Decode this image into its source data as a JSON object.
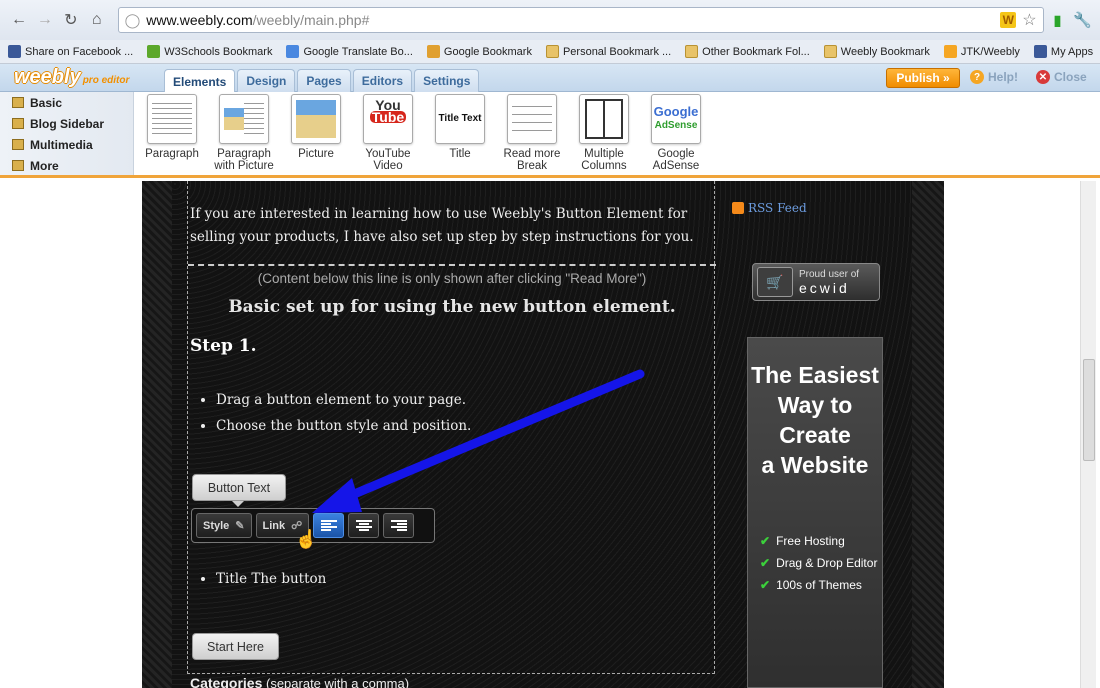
{
  "browser": {
    "url_host": "www.weebly.com",
    "url_path": "/weebly/main.php#",
    "bookmarks": [
      {
        "label": "Share on Facebook ...",
        "icon": "facebook-icon"
      },
      {
        "label": "W3Schools Bookmark",
        "icon": "w3-icon"
      },
      {
        "label": "Google Translate Bo...",
        "icon": "translate-icon"
      },
      {
        "label": "Google Bookmark",
        "icon": "google-icon"
      },
      {
        "label": "Personal Bookmark ...",
        "icon": "folder-icon"
      },
      {
        "label": "Other Bookmark Fol...",
        "icon": "folder-icon"
      },
      {
        "label": "Weebly Bookmark",
        "icon": "folder-icon"
      },
      {
        "label": "JTK/Weebly",
        "icon": "weebly-icon"
      },
      {
        "label": "My Apps",
        "icon": "facebook-icon"
      }
    ]
  },
  "editor": {
    "logo": "weebly",
    "logo_sub": "pro editor",
    "tabs": [
      "Elements",
      "Design",
      "Pages",
      "Editors",
      "Settings"
    ],
    "publish": "Publish »",
    "help": "Help!",
    "close": "Close",
    "categories": [
      "Basic",
      "Blog Sidebar",
      "Multimedia",
      "More"
    ],
    "elements": [
      {
        "label": "Paragraph",
        "sub": ""
      },
      {
        "label": "Paragraph",
        "sub": "with Picture"
      },
      {
        "label": "Picture",
        "sub": ""
      },
      {
        "label": "YouTube",
        "sub": "Video"
      },
      {
        "label": "Title",
        "sub": ""
      },
      {
        "label": "Read more",
        "sub": "Break"
      },
      {
        "label": "Multiple",
        "sub": "Columns"
      },
      {
        "label": "Google",
        "sub": "AdSense"
      }
    ],
    "youtube_thumb": [
      "You",
      "Tube"
    ],
    "title_thumb": "Title Text",
    "google_thumb": [
      "Google",
      "AdSense"
    ]
  },
  "page": {
    "intro": "If you are interested in learning how to use Weebly's Button Element for selling your products, I have also set up step by step instructions for you.",
    "read_more_note": "(Content below this line is only shown after clicking \"Read More\")",
    "heading": "Basic set up for using the new button element.",
    "step": "Step 1.",
    "bullets": [
      "Drag a button element to your page.",
      "Choose the button style and  position."
    ],
    "button_text": "Button Text",
    "toolbar": {
      "style": "Style",
      "link": "Link"
    },
    "bullets2": [
      "Title The button"
    ],
    "start_button": "Start Here",
    "categories_label": "Categories",
    "categories_hint": "(separate with a comma)"
  },
  "sidebar": {
    "rss": "RSS Feed",
    "ecwid_line1": "Proud user of",
    "ecwid_line2": "ecwid",
    "ad_title": [
      "The Easiest",
      "Way to",
      "Create",
      "a Website"
    ],
    "ad_features": [
      "Free Hosting",
      "Drag & Drop Editor",
      "100s of Themes"
    ]
  },
  "colors": {
    "accent": "#f08c00",
    "tab_text": "#3d6b9c",
    "arrow": "#1515e8",
    "selected_align": "#2f6fd0"
  }
}
